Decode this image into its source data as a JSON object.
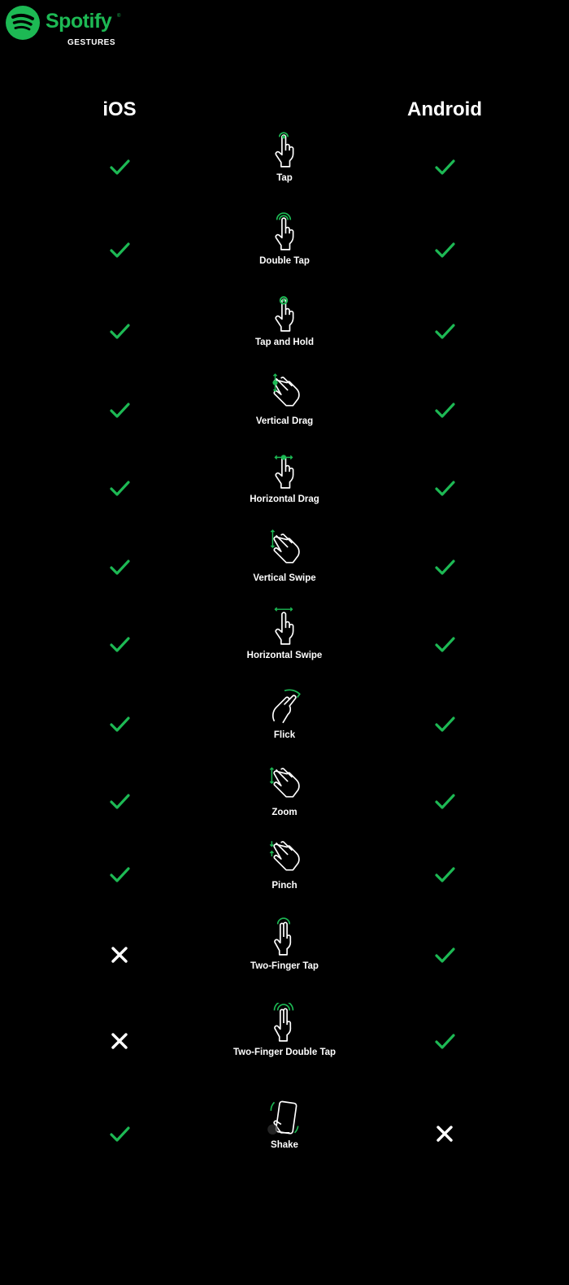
{
  "brand": {
    "name": "Spotify",
    "trademark": "®",
    "subtitle": "GESTURES",
    "color": "#1DB954"
  },
  "columns": {
    "left": "iOS",
    "right": "Android"
  },
  "gestures": [
    {
      "label": "Tap",
      "icon": "tap-icon",
      "ios": true,
      "android": true
    },
    {
      "label": "Double Tap",
      "icon": "double-tap-icon",
      "ios": true,
      "android": true
    },
    {
      "label": "Tap and Hold",
      "icon": "tap-and-hold-icon",
      "ios": true,
      "android": true
    },
    {
      "label": "Vertical Drag",
      "icon": "vertical-drag-icon",
      "ios": true,
      "android": true
    },
    {
      "label": "Horizontal Drag",
      "icon": "horizontal-drag-icon",
      "ios": true,
      "android": true
    },
    {
      "label": "Vertical Swipe",
      "icon": "vertical-swipe-icon",
      "ios": true,
      "android": true
    },
    {
      "label": "Horizontal Swipe",
      "icon": "horizontal-swipe-icon",
      "ios": true,
      "android": true
    },
    {
      "label": "Flick",
      "icon": "flick-icon",
      "ios": true,
      "android": true
    },
    {
      "label": "Zoom",
      "icon": "zoom-icon",
      "ios": true,
      "android": true
    },
    {
      "label": "Pinch",
      "icon": "pinch-icon",
      "ios": true,
      "android": true
    },
    {
      "label": "Two-Finger Tap",
      "icon": "two-finger-tap-icon",
      "ios": false,
      "android": true
    },
    {
      "label": "Two-Finger Double Tap",
      "icon": "two-finger-double-tap-icon",
      "ios": false,
      "android": true
    },
    {
      "label": "Shake",
      "icon": "shake-icon",
      "ios": true,
      "android": false
    }
  ],
  "colors": {
    "check": "#1DB954",
    "cross": "#FFFFFF",
    "background": "#000000"
  }
}
